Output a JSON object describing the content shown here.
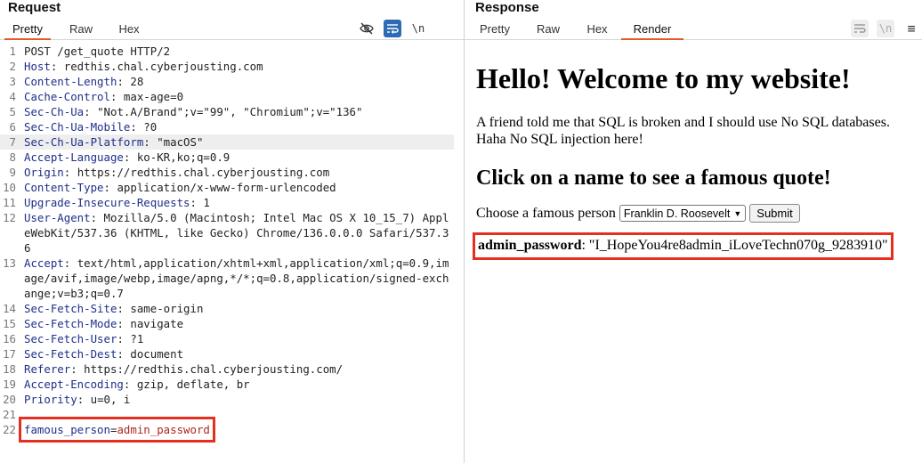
{
  "request": {
    "title": "Request",
    "tabs": [
      "Pretty",
      "Raw",
      "Hex"
    ],
    "active_tab": "Pretty",
    "toolbar": {
      "hide_icon": "eye-slash-icon",
      "wrap_icon": "wrap-lines-icon",
      "newline_label": "\\n"
    },
    "request_line": "POST /get_quote HTTP/2",
    "headers": [
      {
        "n": 2,
        "key": "Host",
        "value": "redthis.chal.cyberjousting.com"
      },
      {
        "n": 3,
        "key": "Content-Length",
        "value": "28"
      },
      {
        "n": 4,
        "key": "Cache-Control",
        "value": "max-age=0"
      },
      {
        "n": 5,
        "key": "Sec-Ch-Ua",
        "value": "\"Not.A/Brand\";v=\"99\", \"Chromium\";v=\"136\""
      },
      {
        "n": 6,
        "key": "Sec-Ch-Ua-Mobile",
        "value": "?0"
      },
      {
        "n": 7,
        "key": "Sec-Ch-Ua-Platform",
        "value": "\"macOS\"",
        "highlight": true
      },
      {
        "n": 8,
        "key": "Accept-Language",
        "value": "ko-KR,ko;q=0.9"
      },
      {
        "n": 9,
        "key": "Origin",
        "value": "https://redthis.chal.cyberjousting.com"
      },
      {
        "n": 10,
        "key": "Content-Type",
        "value": "application/x-www-form-urlencoded"
      },
      {
        "n": 11,
        "key": "Upgrade-Insecure-Requests",
        "value": "1"
      },
      {
        "n": 12,
        "key": "User-Agent",
        "value": "Mozilla/5.0 (Macintosh; Intel Mac OS X 10_15_7) AppleWebKit/537.36 (KHTML, like Gecko) Chrome/136.0.0.0 Safari/537.36"
      },
      {
        "n": 13,
        "key": "Accept",
        "value": "text/html,application/xhtml+xml,application/xml;q=0.9,image/avif,image/webp,image/apng,*/*;q=0.8,application/signed-exchange;v=b3;q=0.7"
      },
      {
        "n": 14,
        "key": "Sec-Fetch-Site",
        "value": "same-origin"
      },
      {
        "n": 15,
        "key": "Sec-Fetch-Mode",
        "value": "navigate"
      },
      {
        "n": 16,
        "key": "Sec-Fetch-User",
        "value": "?1"
      },
      {
        "n": 17,
        "key": "Sec-Fetch-Dest",
        "value": "document"
      },
      {
        "n": 18,
        "key": "Referer",
        "value": "https://redthis.chal.cyberjousting.com/"
      },
      {
        "n": 19,
        "key": "Accept-Encoding",
        "value": "gzip, deflate, br"
      },
      {
        "n": 20,
        "key": "Priority",
        "value": "u=0, i"
      }
    ],
    "blank_line_n": 21,
    "body_line_n": 22,
    "body": {
      "key": "famous_person",
      "eq": "=",
      "value": "admin_password"
    }
  },
  "response": {
    "title": "Response",
    "tabs": [
      "Pretty",
      "Raw",
      "Hex",
      "Render"
    ],
    "active_tab": "Render",
    "toolbar": {
      "wrap_icon": "wrap-lines-icon",
      "newline_label": "\\n",
      "menu_label": "≡"
    },
    "render": {
      "heading": "Hello! Welcome to my website!",
      "paragraph": "A friend told me that SQL is broken and I should use No SQL databases. Haha No SQL injection here!",
      "subheading": "Click on a name to see a famous quote!",
      "form_label": "Choose a famous person",
      "select_value": "Franklin D. Roosevelt",
      "submit_label": "Submit",
      "result_key": "admin_password",
      "result_value": ": \"I_HopeYou4re8admin_iLoveTechn070g_9283910\""
    }
  },
  "colors": {
    "accent": "#e8582a",
    "highlight_box": "#e53020",
    "header_key": "#1f2f8a",
    "param_value": "#b0261e",
    "toggle_on": "#2d6bb5"
  }
}
